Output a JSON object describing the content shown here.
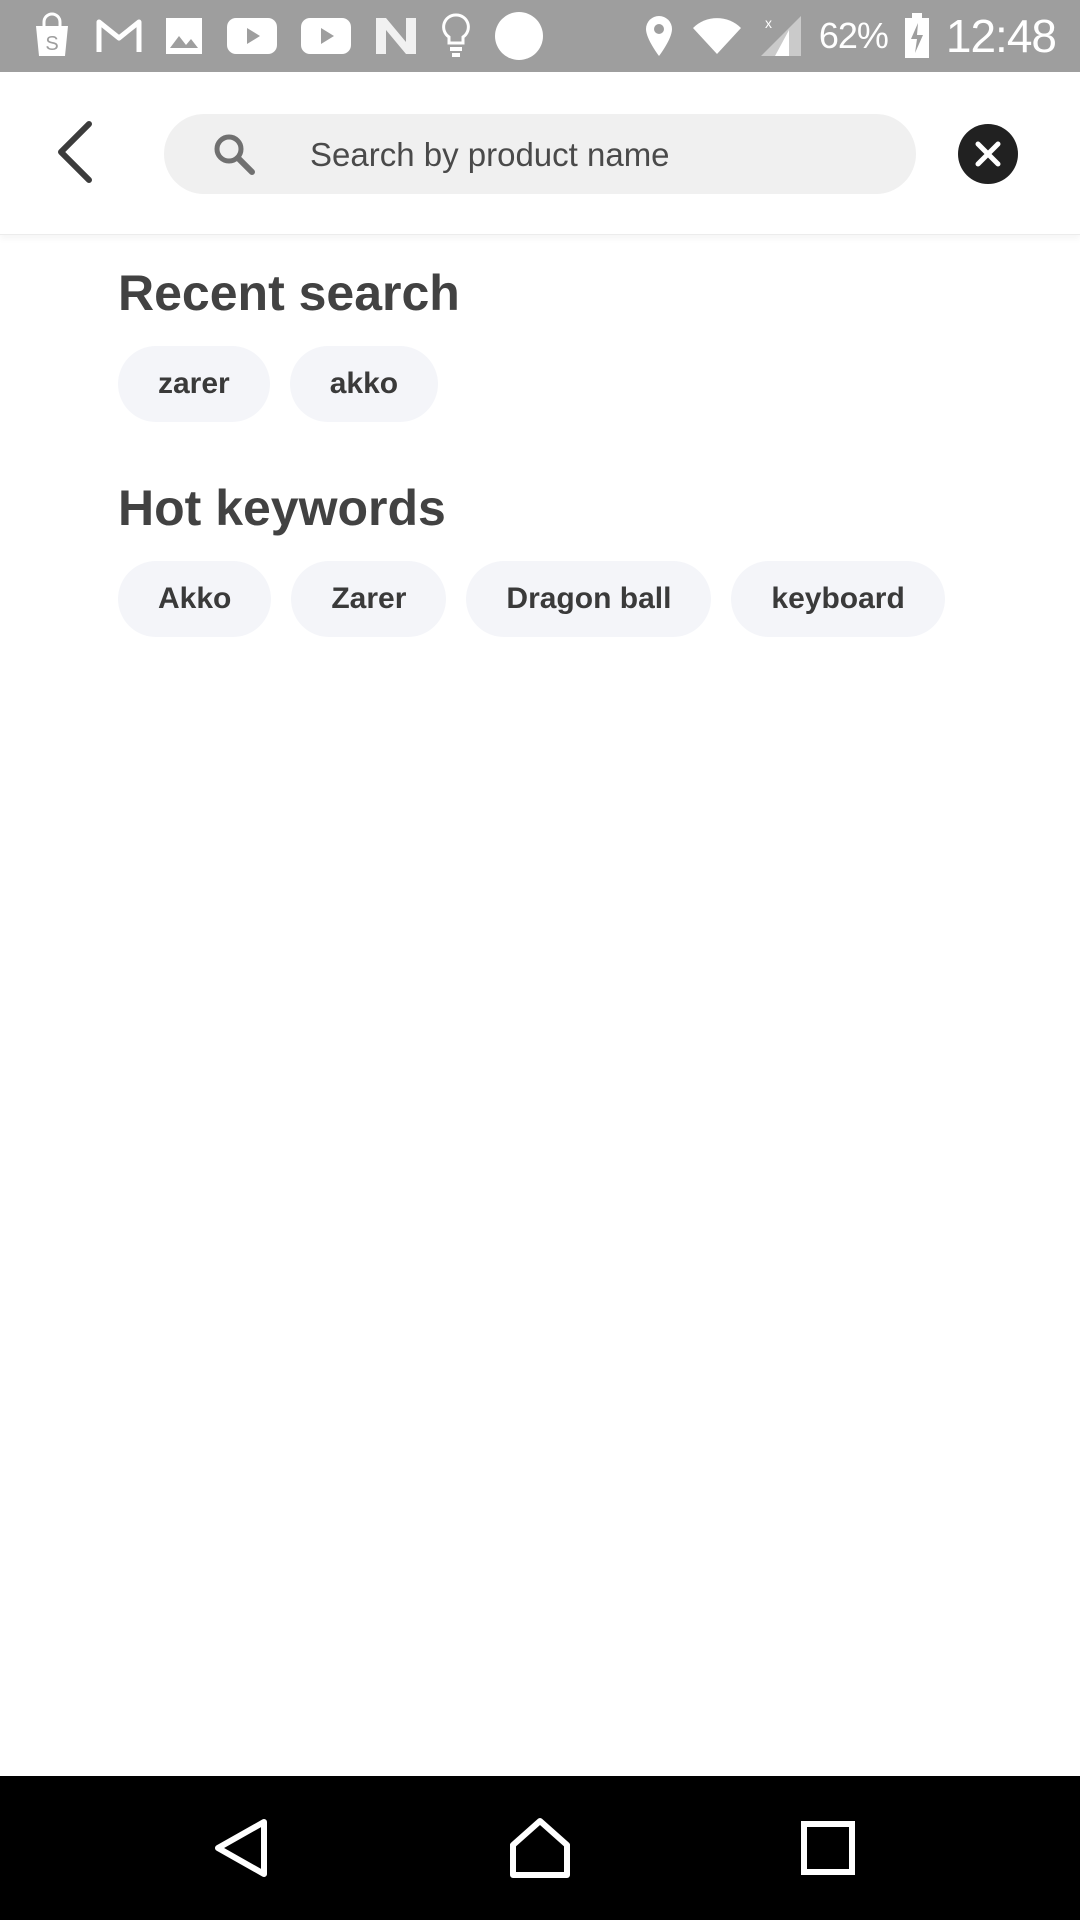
{
  "status_bar": {
    "left_icons": [
      "shopping-bag-icon",
      "gmail-icon",
      "image-icon",
      "youtube-icon",
      "youtube-icon",
      "n-app-icon",
      "lightbulb-icon",
      "circle-icon"
    ],
    "right_icons": [
      "location-icon",
      "wifi-icon",
      "signal-icon",
      "battery-charging-icon"
    ],
    "battery": "62%",
    "time": "12:48"
  },
  "header": {
    "back_icon": "chevron-left-icon",
    "search": {
      "placeholder": "Search by product name",
      "value": ""
    },
    "clear_icon": "close-circle-icon"
  },
  "recent_search": {
    "title": "Recent search",
    "items": [
      {
        "label": "zarer"
      },
      {
        "label": "akko"
      }
    ]
  },
  "hot_keywords": {
    "title": "Hot keywords",
    "items": [
      {
        "label": "Akko"
      },
      {
        "label": "Zarer"
      },
      {
        "label": "Dragon ball"
      },
      {
        "label": "keyboard"
      }
    ]
  },
  "nav_bar": {
    "icons": [
      "back-triangle-icon",
      "home-icon",
      "recents-icon"
    ]
  },
  "colors": {
    "status_bar_bg": "#9e9e9e",
    "search_bg": "#f0f0f0",
    "chip_bg": "#f4f5f9",
    "title_text": "#424242",
    "nav_bar_bg": "#000000"
  }
}
